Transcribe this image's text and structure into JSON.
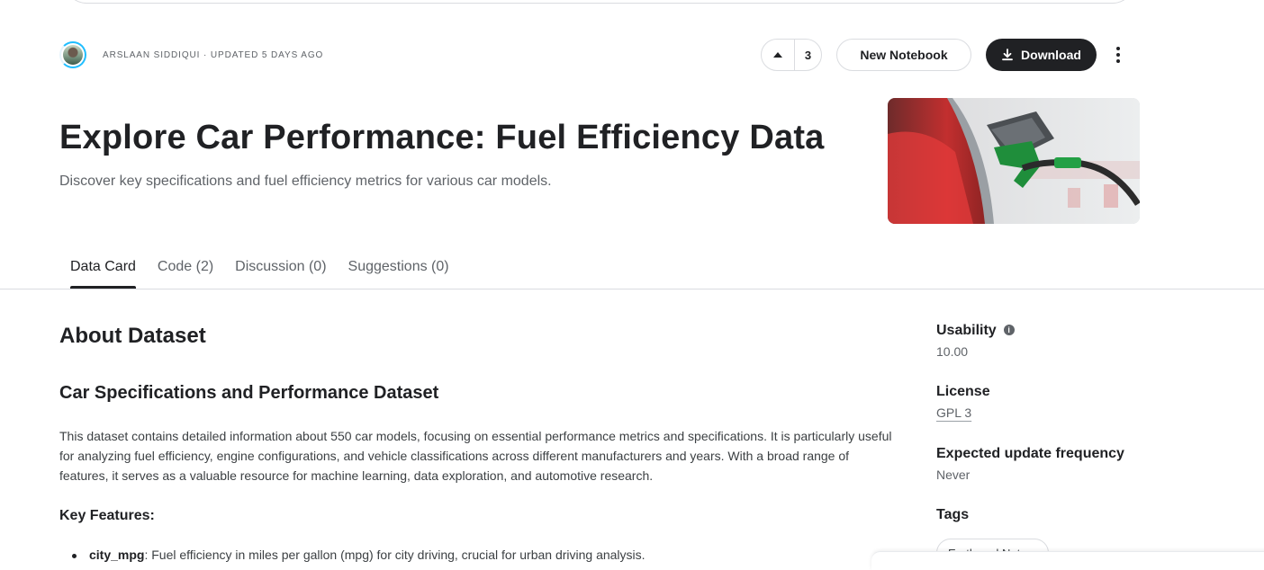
{
  "header": {
    "author_meta": "ARSLAAN SIDDIQUI · UPDATED 5 DAYS AGO",
    "vote_count": "3",
    "new_notebook_label": "New Notebook",
    "download_label": "Download"
  },
  "hero": {
    "title": "Explore Car Performance: Fuel Efficiency Data",
    "subtitle": "Discover key specifications and fuel efficiency metrics for various car models."
  },
  "tabs": [
    {
      "label": "Data Card",
      "active": true
    },
    {
      "label": "Code (2)",
      "active": false
    },
    {
      "label": "Discussion (0)",
      "active": false
    },
    {
      "label": "Suggestions (0)",
      "active": false
    }
  ],
  "content": {
    "about_heading": "About Dataset",
    "spec_heading": "Car Specifications and Performance Dataset",
    "description": "This dataset contains detailed information about 550 car models, focusing on essential performance metrics and specifications. It is particularly useful for analyzing fuel efficiency, engine configurations, and vehicle classifications across different manufacturers and years. With a broad range of features, it serves as a valuable resource for machine learning, data exploration, and automotive research.",
    "features_heading": "Key Features:",
    "first_feature": {
      "name": "city_mpg",
      "text": ": Fuel efficiency in miles per gallon (mpg) for city driving, crucial for urban driving analysis."
    }
  },
  "sidebar": {
    "usability_label": "Usability",
    "usability_value": "10.00",
    "license_label": "License",
    "license_value": "GPL 3",
    "frequency_label": "Expected update frequency",
    "frequency_value": "Never",
    "tags_label": "Tags",
    "tags": [
      "Earth and Nature"
    ]
  },
  "colors": {
    "primary_text": "#202124",
    "secondary_text": "#5f6368",
    "download_bg": "#202124",
    "avatar_ring": "#20beff"
  },
  "icons": {
    "vote": "triangle-up-icon",
    "download": "download-icon",
    "more": "more-vertical-icon",
    "info": "info-icon"
  }
}
